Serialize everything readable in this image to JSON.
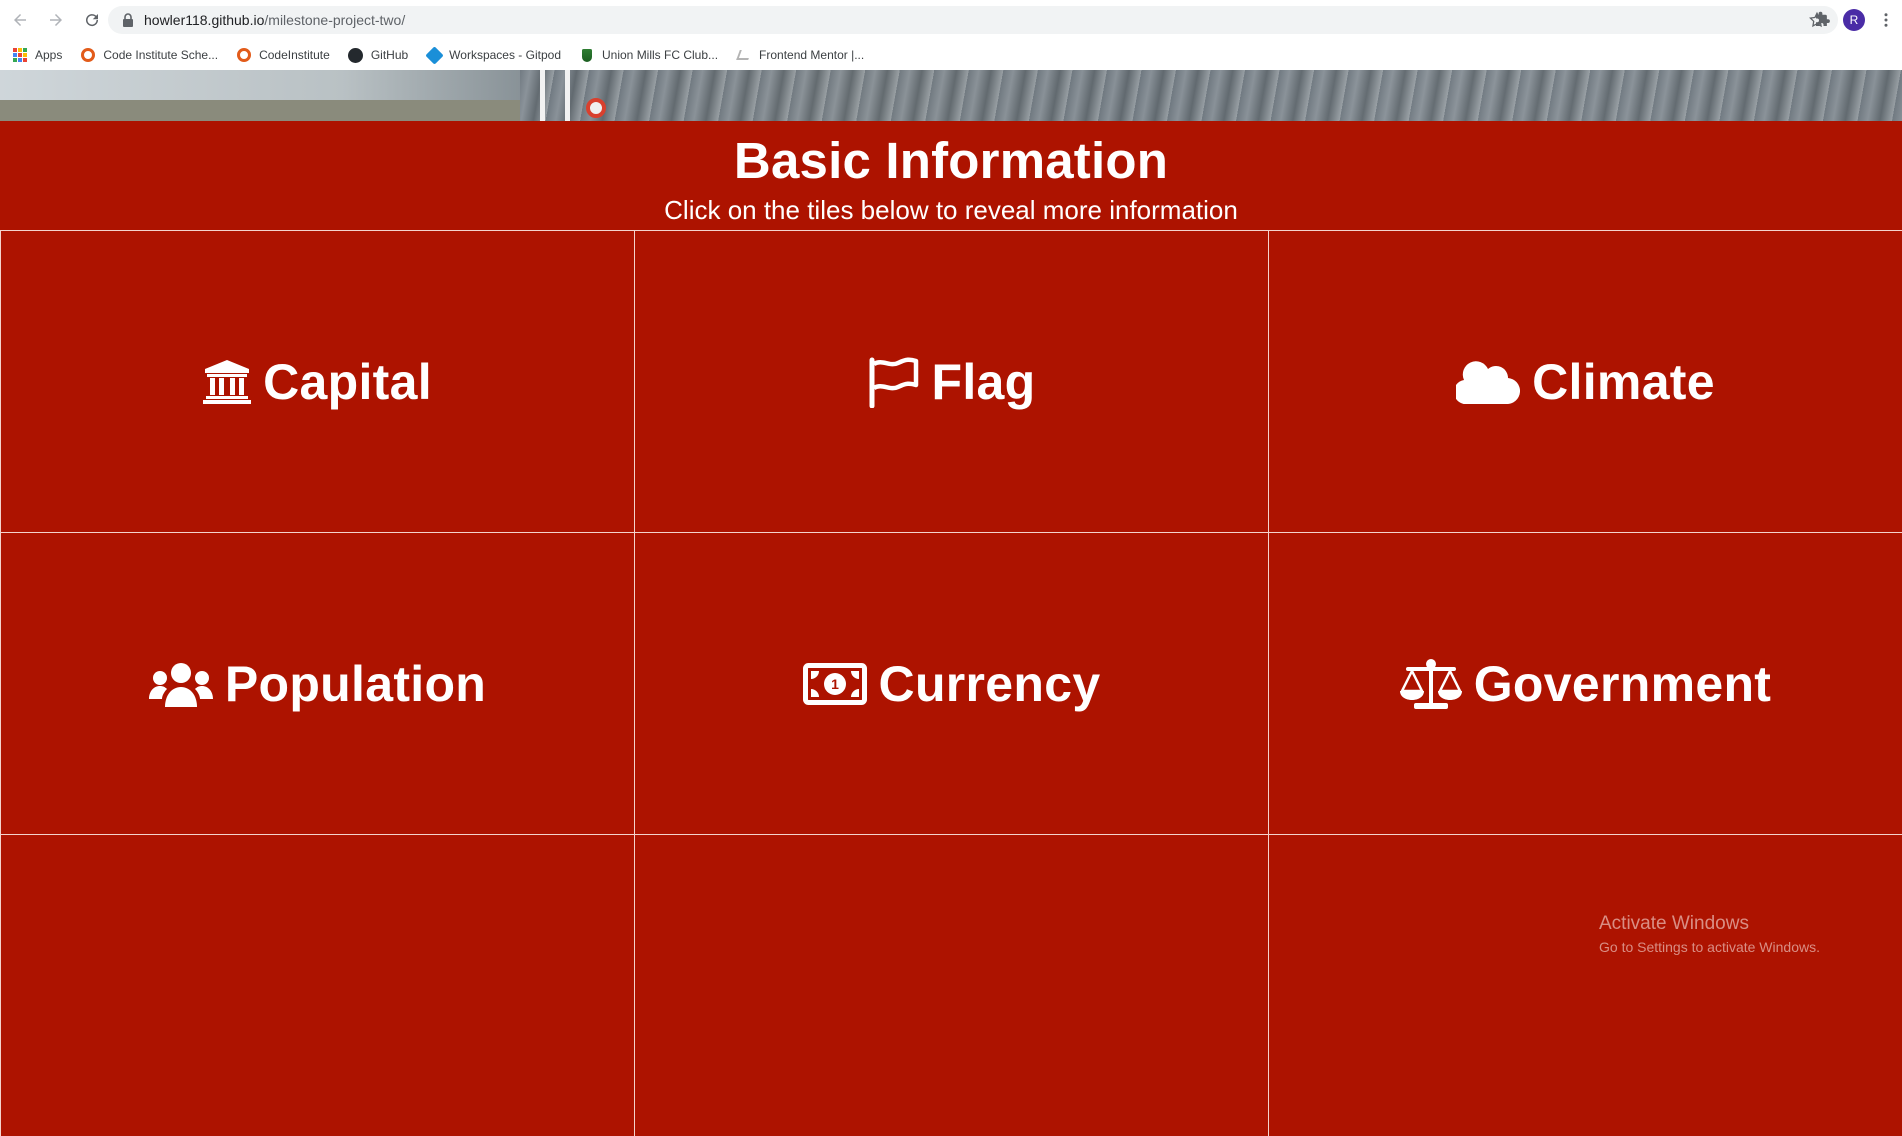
{
  "browser": {
    "url_host": "howler118.github.io",
    "url_path": "/milestone-project-two/",
    "profile_initial": "R",
    "bookmarks": [
      {
        "label": "Apps",
        "icon": "apps-grid-icon"
      },
      {
        "label": "Code Institute Sche...",
        "icon": "code-institute-icon"
      },
      {
        "label": "CodeInstitute",
        "icon": "code-institute-icon"
      },
      {
        "label": "GitHub",
        "icon": "github-icon"
      },
      {
        "label": "Workspaces - Gitpod",
        "icon": "gitpod-icon"
      },
      {
        "label": "Union Mills FC Club...",
        "icon": "union-mills-icon"
      },
      {
        "label": "Frontend Mentor |...",
        "icon": "frontend-mentor-icon"
      }
    ]
  },
  "section": {
    "title": "Basic Information",
    "subtitle": "Click on the tiles below to reveal more information"
  },
  "tiles": [
    {
      "label": "Capital",
      "icon": "landmark-icon"
    },
    {
      "label": "Flag",
      "icon": "flag-icon"
    },
    {
      "label": "Climate",
      "icon": "cloud-icon"
    },
    {
      "label": "Population",
      "icon": "users-icon"
    },
    {
      "label": "Currency",
      "icon": "money-bill-icon"
    },
    {
      "label": "Government",
      "icon": "balance-scale-icon"
    },
    {
      "label": "",
      "icon": ""
    },
    {
      "label": "",
      "icon": ""
    },
    {
      "label": "",
      "icon": ""
    }
  ],
  "watermark": {
    "title": "Activate Windows",
    "subtitle": "Go to Settings to activate Windows."
  },
  "colors": {
    "page_background": "#ad1300",
    "tile_border": "#f4d3cc",
    "text": "#ffffff"
  }
}
